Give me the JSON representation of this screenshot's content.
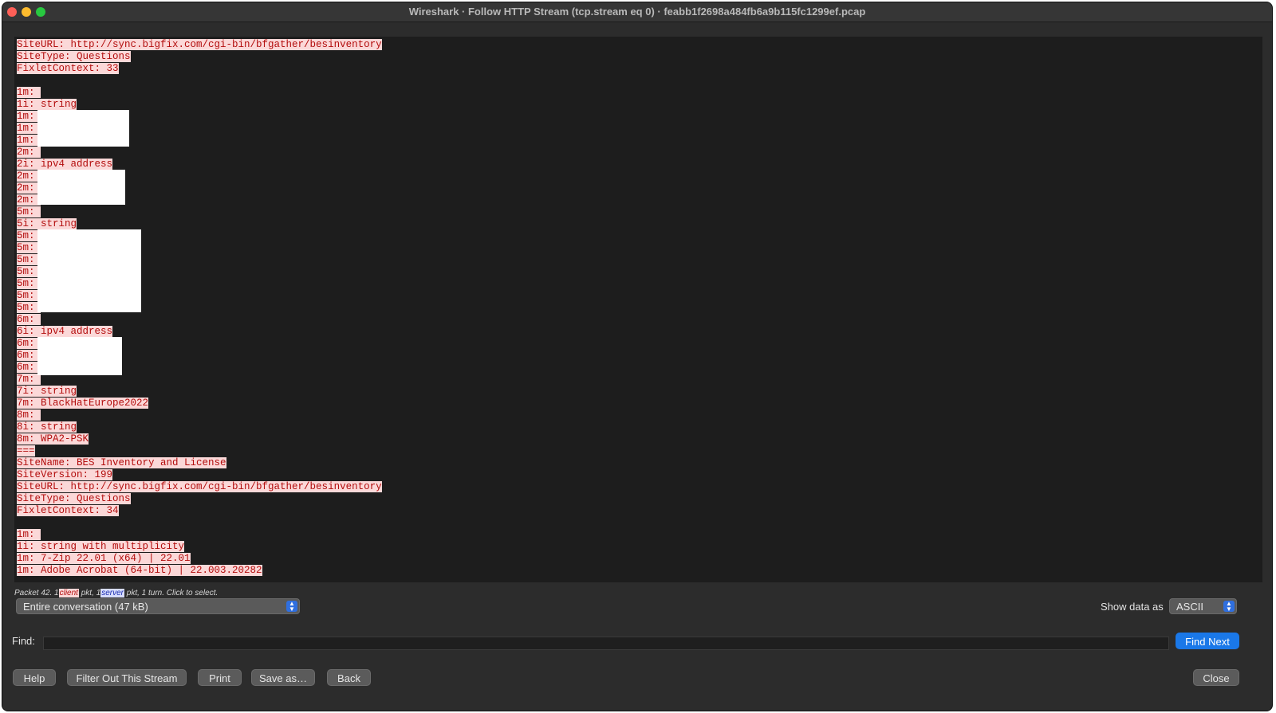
{
  "window": {
    "title": "Wireshark · Follow HTTP Stream (tcp.stream eq 0) · feabb1f2698a484fb6a9b115fc1299ef.pcap"
  },
  "stream": {
    "lines": [
      "SiteURL: http://sync.bigfix.com/cgi-bin/bfgather/besinventory",
      "SiteType: Questions",
      "FixletContext: 33",
      "",
      "1m: ",
      "1i: string",
      "1m: ",
      "1m: ",
      "1m: ",
      "2m: ",
      "2i: ipv4 address",
      "2m: ",
      "2m: ",
      "2m: ",
      "5m: ",
      "5i: string",
      "5m: ",
      "5m: ",
      "5m: ",
      "5m: ",
      "5m: ",
      "5m: ",
      "5m: ",
      "6m: ",
      "6i: ipv4 address",
      "6m: ",
      "6m: ",
      "6m: ",
      "7m: ",
      "7i: string",
      "7m: BlackHatEurope2022",
      "8m: ",
      "8i: string",
      "8m: WPA2-PSK",
      "===",
      "SiteName: BES Inventory and License",
      "SiteVersion: 199",
      "SiteURL: http://sync.bigfix.com/cgi-bin/bfgather/besinventory",
      "SiteType: Questions",
      "FixletContext: 34",
      "",
      "1m: ",
      "1i: string with multiplicity",
      "1m: 7-Zip 22.01 (x64) | 22.01",
      "1m: Adobe Acrobat (64-bit) | 22.003.20282"
    ],
    "text_color": "#b30d0d",
    "highlight_color": "#fbd8d8"
  },
  "packet_info": {
    "prefix": "Packet 42. 1",
    "client_label": "client",
    "middle": " pkt, 1",
    "server_label": "server",
    "suffix": " pkt, 1 turn. Click to select."
  },
  "conversation_select": {
    "value": "Entire conversation (47 kB)"
  },
  "show_data": {
    "label": "Show data as",
    "value": "ASCII"
  },
  "find": {
    "label": "Find:",
    "value": "",
    "button": "Find Next"
  },
  "buttons": {
    "help": "Help",
    "filter_out": "Filter Out This Stream",
    "print": "Print",
    "save_as": "Save as…",
    "back": "Back",
    "close": "Close"
  },
  "colors": {
    "accent": "#1a78e8",
    "background": "#2c2c2c"
  }
}
